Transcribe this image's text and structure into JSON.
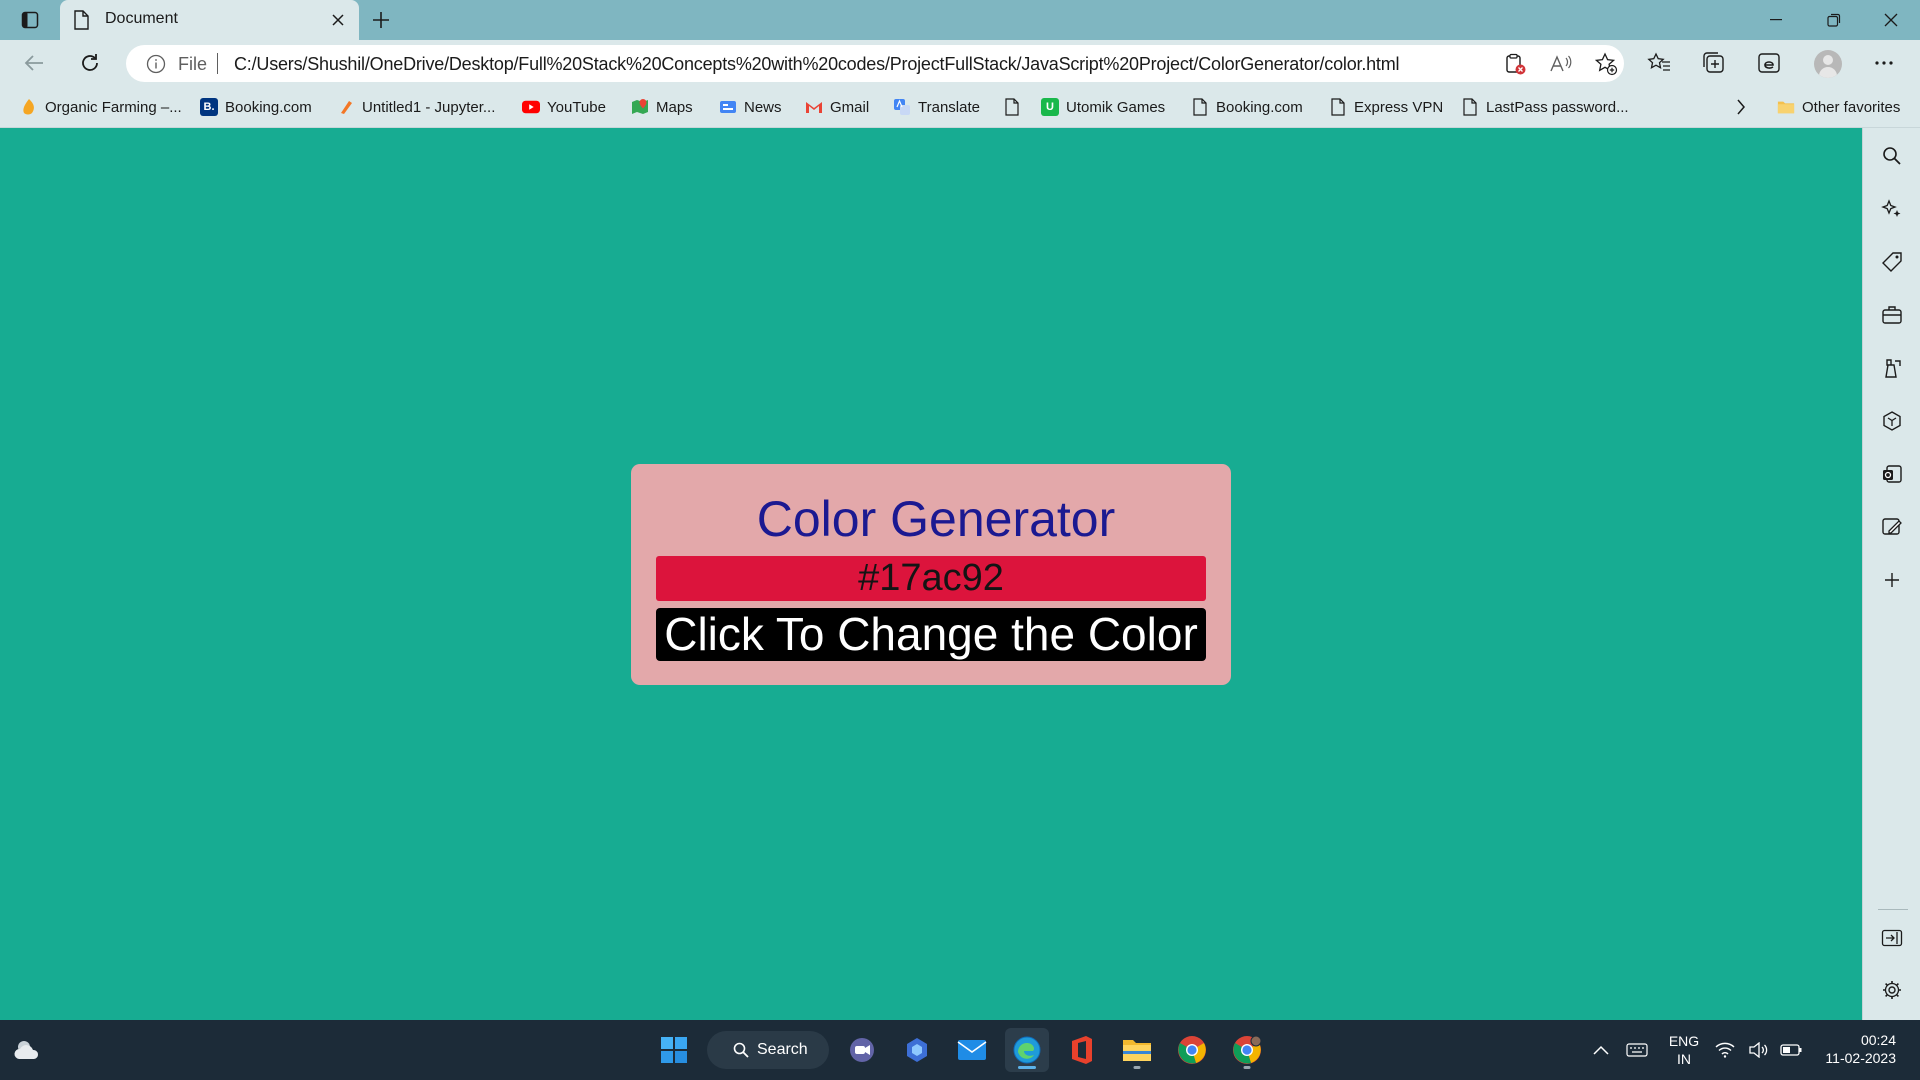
{
  "browser": {
    "tab_title": "Document",
    "address": {
      "scheme_label": "File",
      "url": "C:/Users/Shushil/OneDrive/Desktop/Full%20Stack%20Concepts%20with%20codes/ProjectFullStack/JavaScript%20Project/ColorGenerator/color.html"
    },
    "favorites": [
      {
        "label": "Organic Farming –...",
        "icon": "organic-icon"
      },
      {
        "label": "Booking.com",
        "icon": "booking-icon"
      },
      {
        "label": "Untitled1 - Jupyter...",
        "icon": "jupyter-icon"
      },
      {
        "label": "YouTube",
        "icon": "youtube-icon"
      },
      {
        "label": "Maps",
        "icon": "maps-icon"
      },
      {
        "label": "News",
        "icon": "news-icon"
      },
      {
        "label": "Gmail",
        "icon": "gmail-icon"
      },
      {
        "label": "Translate",
        "icon": "translate-icon"
      },
      {
        "label": "",
        "icon": "page-icon"
      },
      {
        "label": "Utomik Games",
        "icon": "utomik-icon"
      },
      {
        "label": "Booking.com",
        "icon": "page-icon"
      },
      {
        "label": "Express VPN",
        "icon": "page-icon"
      },
      {
        "label": "LastPass password...",
        "icon": "page-icon"
      }
    ],
    "other_favorites": "Other favorites"
  },
  "page": {
    "background_color": "#17ac92",
    "card": {
      "title": "Color Generator",
      "color_code": "#17ac92",
      "button_label": "Click To Change the Color",
      "card_color": "#e3a8aa",
      "display_color": "#dc143c"
    }
  },
  "taskbar": {
    "search_label": "Search",
    "language_line1": "ENG",
    "language_line2": "IN",
    "time": "00:24",
    "date": "11-02-2023"
  }
}
